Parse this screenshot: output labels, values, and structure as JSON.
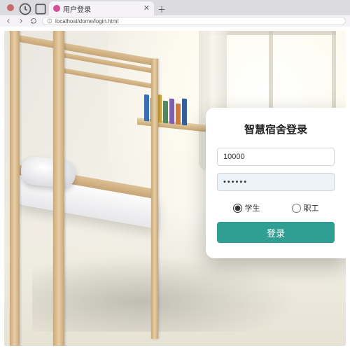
{
  "browser": {
    "tab_title": "用户登录",
    "url": "localhost/dome/login.html"
  },
  "login": {
    "title": "智慧宿舍登录",
    "username_value": "10000",
    "password_masked": "••••••",
    "role_student": "学生",
    "role_staff": "职工",
    "selected_role": "student",
    "submit_label": "登录"
  },
  "colors": {
    "primary": "#2f9e93"
  }
}
